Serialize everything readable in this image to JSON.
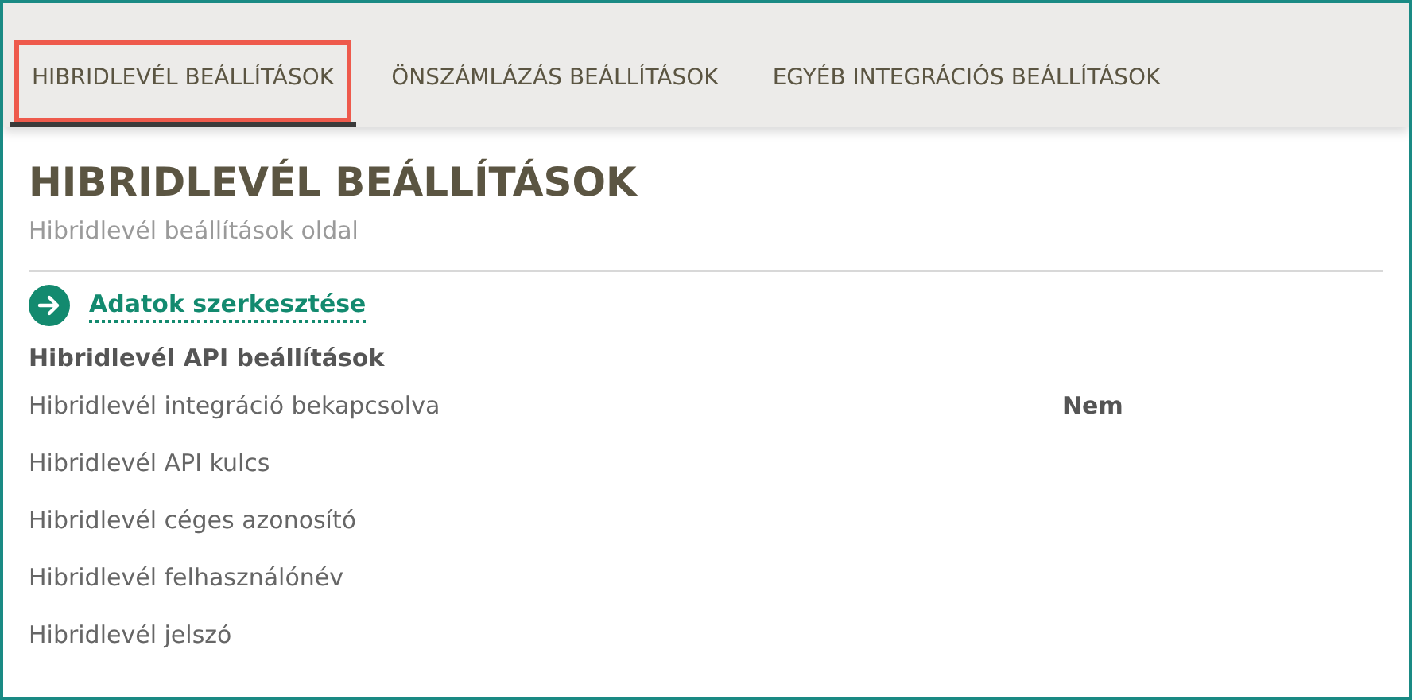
{
  "tabs": [
    {
      "label": "HIBRIDLEVÉL BEÁLLÍTÁSOK",
      "selected": true
    },
    {
      "label": "ÖNSZÁMLÁZÁS BEÁLLÍTÁSOK",
      "selected": false
    },
    {
      "label": "EGYÉB INTEGRÁCIÓS BEÁLLÍTÁSOK",
      "selected": false
    }
  ],
  "page": {
    "title": "HIBRIDLEVÉL BEÁLLÍTÁSOK",
    "subtitle": "Hibridlevél beállítások oldal"
  },
  "edit_link": "Adatok szerkesztése",
  "section": {
    "title": "Hibridlevél API beállítások",
    "rows": [
      {
        "label": "Hibridlevél integráció bekapcsolva",
        "value": "Nem"
      },
      {
        "label": "Hibridlevél API kulcs"
      },
      {
        "label": "Hibridlevél céges azonosító"
      },
      {
        "label": "Hibridlevél felhasználónév"
      },
      {
        "label": "Hibridlevél jelszó"
      }
    ]
  }
}
